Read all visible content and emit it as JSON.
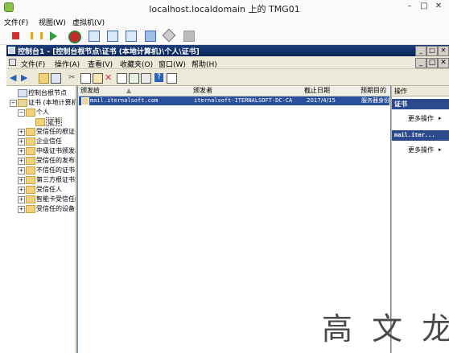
{
  "vm_window": {
    "title": "localhost.localdomain 上的 TMG01",
    "menu": [
      "文件(F)",
      "视图(W)",
      "虚拟机(V)"
    ],
    "controls": [
      "–",
      "□",
      "✕"
    ]
  },
  "mmc": {
    "title": "控制台1 - [控制台根节点\\证书 (本地计算机)\\个人\\证书]",
    "menu": [
      "文件(F)",
      "操作(A)",
      "查看(V)",
      "收藏夹(O)",
      "窗口(W)",
      "帮助(H)"
    ],
    "title_controls": [
      "_",
      "□",
      "✕"
    ],
    "menu_controls": [
      "_",
      "□",
      "✕"
    ]
  },
  "tree": {
    "items": [
      {
        "label": "控制台根节点",
        "expander": ""
      },
      {
        "label": "证书 (本地计算机)",
        "expander": "−"
      },
      {
        "label": "个人",
        "expander": "−"
      },
      {
        "label": "证书",
        "expander": ""
      },
      {
        "label": "受信任的根证书颁发机构",
        "expander": "+"
      },
      {
        "label": "企业信任",
        "expander": "+"
      },
      {
        "label": "中级证书颁发机构",
        "expander": "+"
      },
      {
        "label": "受信任的发布者",
        "expander": "+"
      },
      {
        "label": "不信任的证书",
        "expander": "+"
      },
      {
        "label": "第三方根证书颁发机构",
        "expander": "+"
      },
      {
        "label": "受信任人",
        "expander": "+"
      },
      {
        "label": "智能卡受信任的根",
        "expander": "+"
      },
      {
        "label": "受信任的设备",
        "expander": "+"
      }
    ]
  },
  "list": {
    "columns": [
      "颁发给",
      "颁发者",
      "截止日期",
      "预期目的"
    ],
    "rows": [
      {
        "issued_to": "mail.iternalsoft.com",
        "issued_by": "iternalsoft-ITERNALSOFT-DC-CA",
        "expires": "2017/4/15",
        "purpose": "服务器身份验证"
      }
    ]
  },
  "actions": {
    "header": "操作",
    "sections": [
      {
        "title": "证书",
        "item": "更多操作"
      },
      {
        "title": "mail.iter...",
        "item": "更多操作"
      }
    ]
  },
  "watermark": "高 文 龙",
  "colors": {
    "title_bar": "#0b2459",
    "selection": "#2a4f9b",
    "action_header": "#2b4a8e"
  }
}
